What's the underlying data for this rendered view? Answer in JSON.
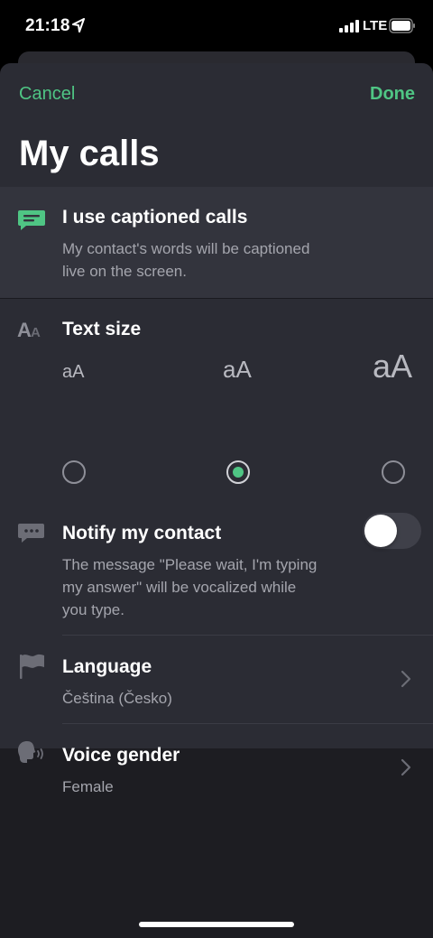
{
  "status_bar": {
    "time": "21:18",
    "network": "LTE"
  },
  "header": {
    "cancel_label": "Cancel",
    "done_label": "Done",
    "title": "My calls"
  },
  "captioned": {
    "title": "I use captioned calls",
    "subtitle_line1": "My contact's words will be captioned",
    "subtitle_line2": "live on the screen."
  },
  "text_size": {
    "title": "Text size",
    "options": [
      {
        "label": "aA",
        "selected": false
      },
      {
        "label": "aA",
        "selected": true
      },
      {
        "label": "aA",
        "selected": false
      }
    ]
  },
  "notify": {
    "title": "Notify my contact",
    "subtitle_line1": "The message \"Please wait, I'm typing",
    "subtitle_line2": "my answer\" will be vocalized while",
    "subtitle_line3": "you type.",
    "enabled": false
  },
  "language": {
    "title": "Language",
    "value": "Čeština (Česko)"
  },
  "voice_gender": {
    "title": "Voice gender",
    "value": "Female"
  },
  "colors": {
    "accent": "#4fc584",
    "background": "#1d1d22",
    "card": "#2b2c34",
    "highlight": "#33343d"
  },
  "icons": [
    "location-arrow-icon",
    "signal-bars-icon",
    "battery-icon",
    "caption-icon",
    "text-size-icon",
    "typing-bubble-icon",
    "flag-icon",
    "speaking-head-icon",
    "chevron-right-icon"
  ]
}
